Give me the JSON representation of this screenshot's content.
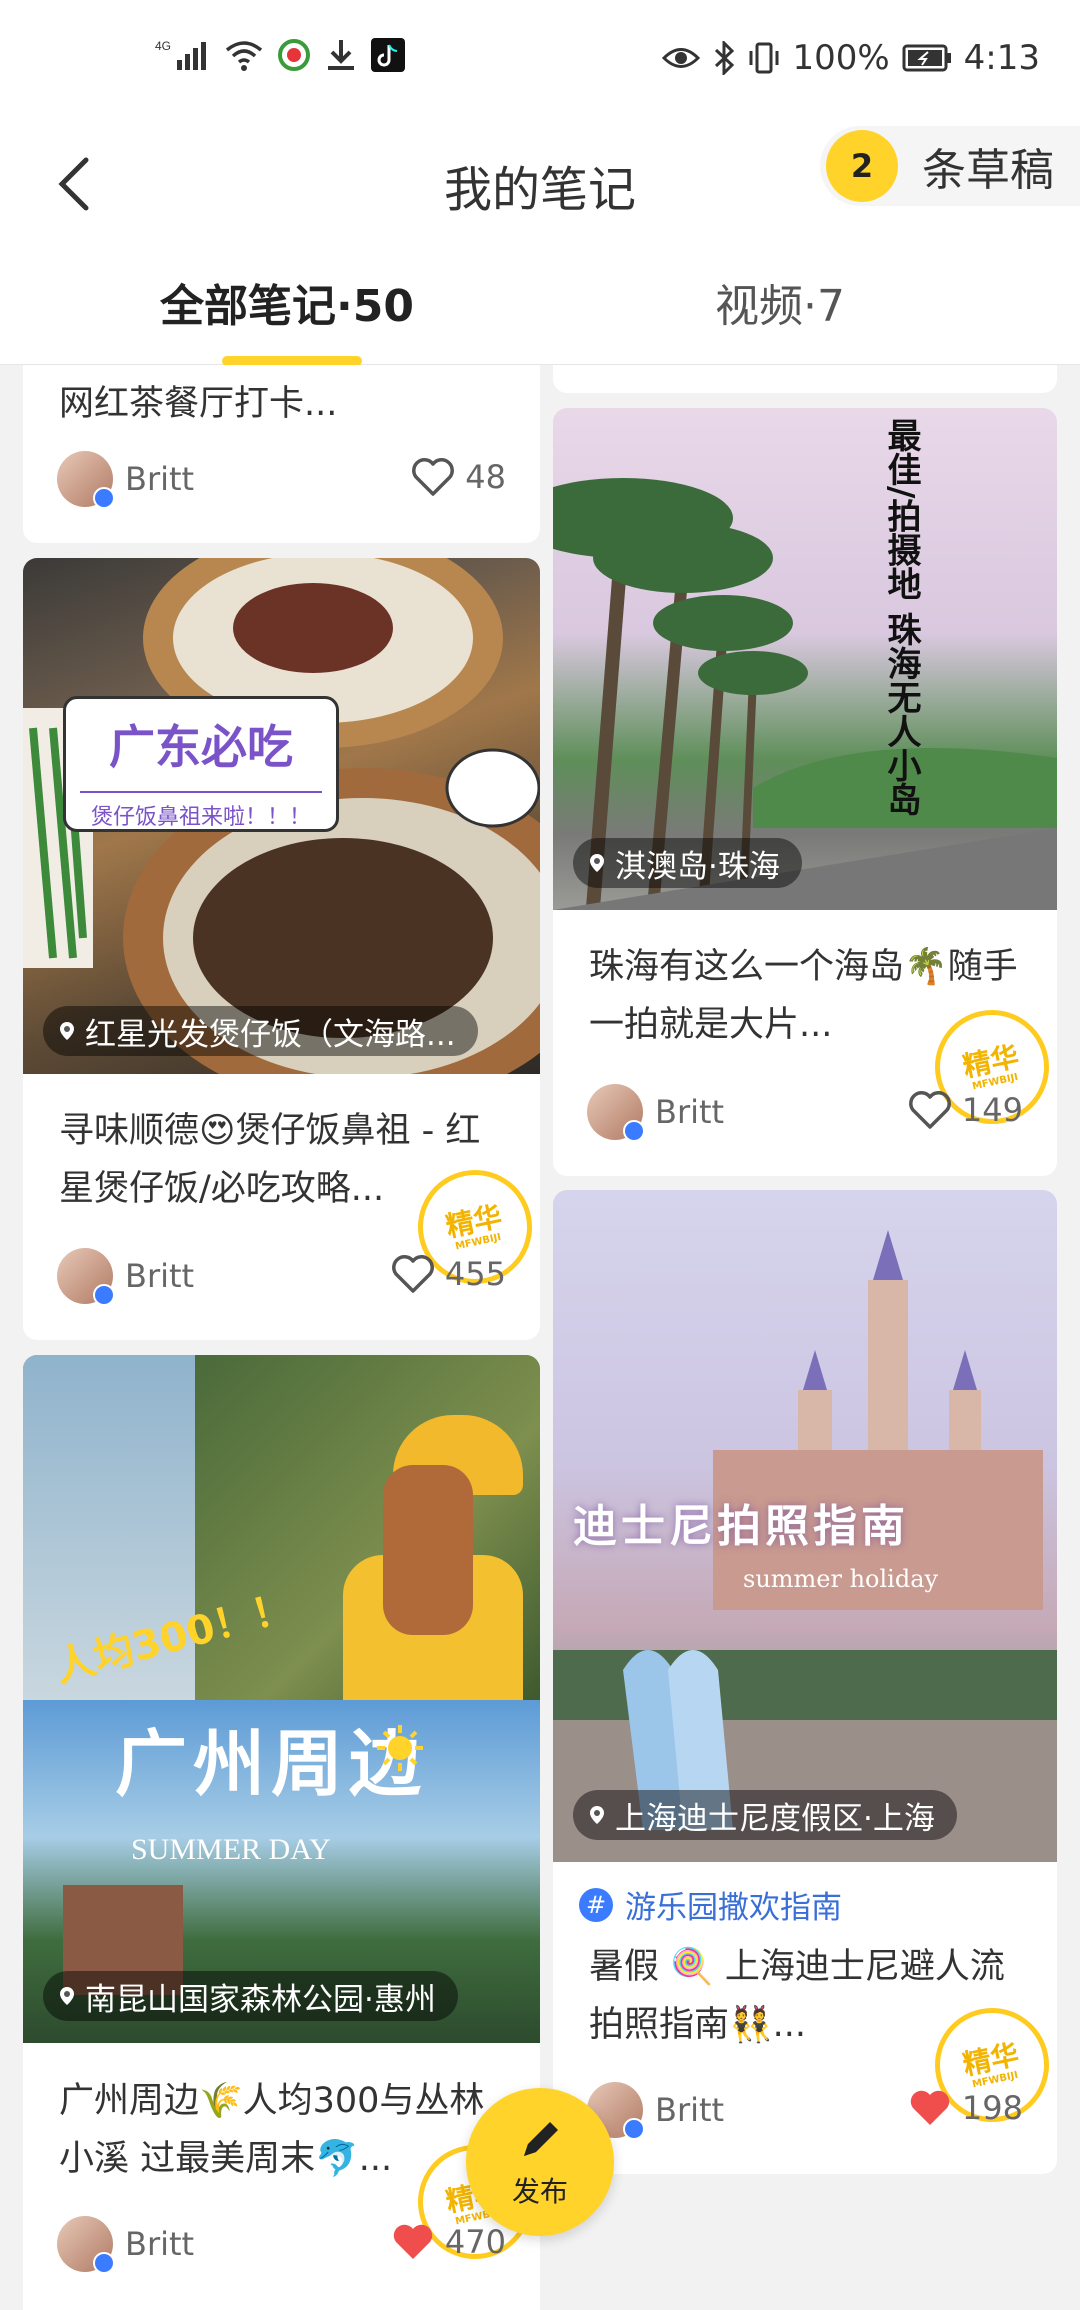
{
  "status": {
    "network": "4G",
    "battery": "100%",
    "time": "4:13"
  },
  "header": {
    "title": "我的笔记",
    "drafts_count": "2",
    "drafts_label": "条草稿"
  },
  "tabs": [
    {
      "label": "全部笔记·50"
    },
    {
      "label": "视频·7"
    }
  ],
  "colors": {
    "accent": "#ffd32a",
    "link": "#3a6fd8",
    "liked": "#f04d4d"
  },
  "cards": {
    "left0": {
      "title": "网红茶餐厅打卡...",
      "author": "Britt",
      "likes": "48"
    },
    "left1": {
      "sticker_title": "广东必吃",
      "sticker_sub": "煲仔饭鼻祖来啦！！！",
      "location": "红星光发煲仔饭（文海路...",
      "title": "寻味顺德😍煲仔饭鼻祖 - 红星煲仔饭/必吃攻略...",
      "author": "Britt",
      "likes": "455",
      "stamp": "精华"
    },
    "left2": {
      "overlay1": "人均300！！",
      "overlay2": "广州周边",
      "overlay3": "SUMMER DAY",
      "location": "南昆山国家森林公园·惠州",
      "title": "广州周边🌾人均300与丛林小溪 过最美周末🐬...",
      "author": "Britt",
      "likes": "470",
      "stamp": "精华"
    },
    "right1": {
      "vertical_text": "最佳/拍摄地 珠海无人小岛",
      "location": "淇澳岛·珠海",
      "title": "珠海有这么一个海岛🌴随手一拍就是大片...",
      "author": "Britt",
      "likes": "149",
      "stamp": "精华"
    },
    "right2": {
      "overlay1": "迪士尼拍照指南",
      "overlay2": "summer holiday",
      "location": "上海迪士尼度假区·上海",
      "topic": "游乐园撒欢指南",
      "title": "暑假 🍭 上海迪士尼避人流拍照指南👯...",
      "author": "Britt",
      "likes": "198",
      "stamp": "精华"
    }
  },
  "publish": {
    "label": "发布"
  }
}
